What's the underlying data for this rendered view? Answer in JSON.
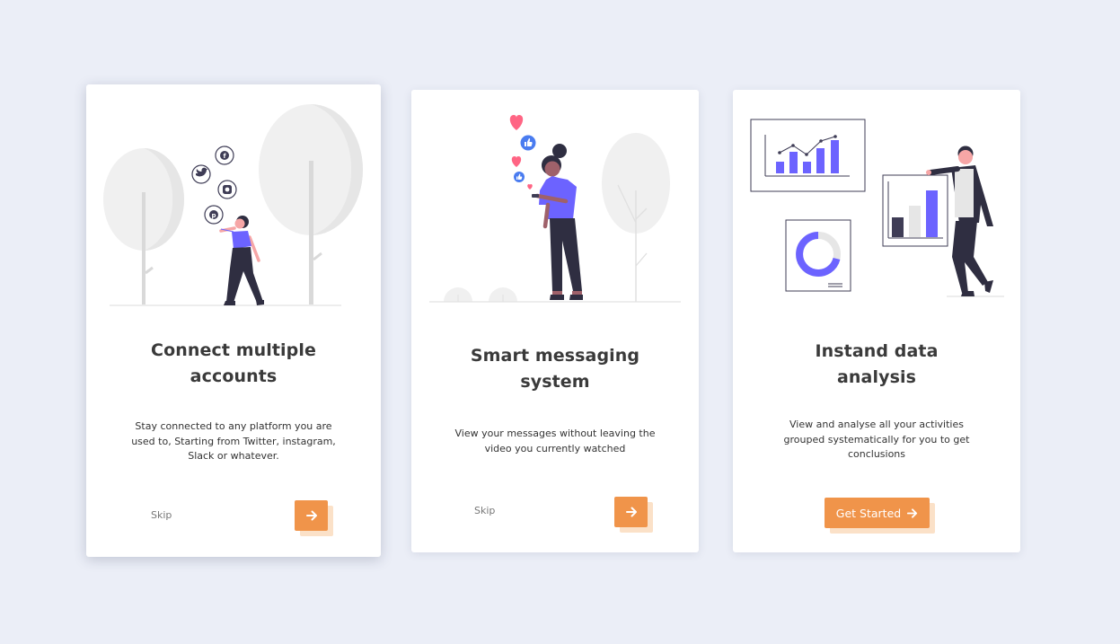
{
  "cards": [
    {
      "title_line1": "Connect multiple",
      "title_line2": "accounts",
      "description": "Stay connected to any platform you are used to, Starting from Twitter, instagram, Slack or whatever.",
      "skip_label": "Skip"
    },
    {
      "title_line1": "Smart messaging",
      "title_line2": "system",
      "description": "View your messages without leaving the video you currently watched",
      "skip_label": "Skip"
    },
    {
      "title_line1": "Instand data",
      "title_line2": "analysis",
      "description": "View and analyse all your activities grouped systematically for you to get conclusions",
      "button_label": "Get Started"
    }
  ],
  "colors": {
    "accent": "#f0944a",
    "accent_shadow": "#fbe1c8",
    "purple": "#6c63ff",
    "background": "#ebeef7"
  }
}
